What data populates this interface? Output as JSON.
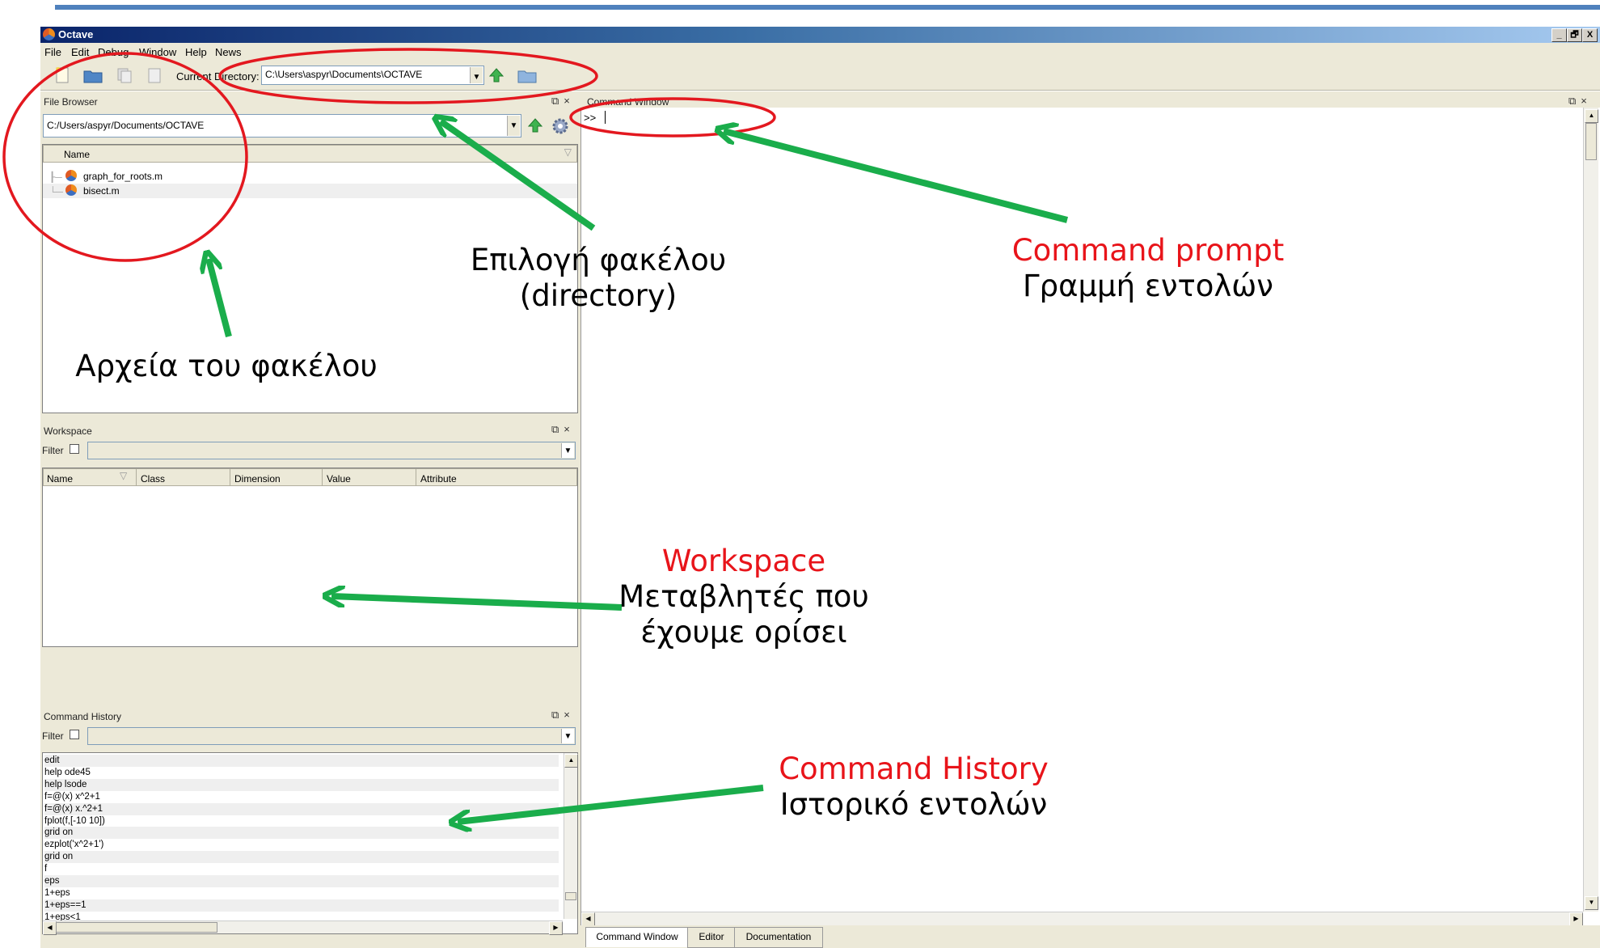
{
  "window": {
    "title": "Octave",
    "controls": [
      "_",
      "🗗",
      "X"
    ]
  },
  "menu": [
    "File",
    "Edit",
    "Debug",
    "Window",
    "Help",
    "News"
  ],
  "toolbar": {
    "dir_label": "Current Directory:",
    "dir_value": "C:\\Users\\aspyr\\Documents\\OCTAVE"
  },
  "file_browser": {
    "title": "File Browser",
    "path": "C:/Users/aspyr/Documents/OCTAVE",
    "column": "Name",
    "files": [
      "graph_for_roots.m",
      "bisect.m"
    ]
  },
  "workspace": {
    "title": "Workspace",
    "filter_label": "Filter",
    "columns": [
      "Name",
      "Class",
      "Dimension",
      "Value",
      "Attribute"
    ]
  },
  "history": {
    "title": "Command History",
    "filter_label": "Filter",
    "entries": [
      "edit",
      "help ode45",
      "help lsode",
      "f=@(x) x^2+1",
      "f=@(x) x.^2+1",
      "fplot(f,[-10 10])",
      "grid on",
      "ezplot('x^2+1')",
      "grid on",
      "f",
      "eps",
      "1+eps",
      "1+eps==1",
      "1+eps<1"
    ]
  },
  "command_window": {
    "title": "Command Window",
    "prompt": ">>"
  },
  "tabs": [
    "Command Window",
    "Editor",
    "Documentation"
  ],
  "annotations": {
    "folder_select": [
      "Επιλογή φακέλου",
      "(directory)"
    ],
    "command_prompt": {
      "title": "Command prompt",
      "subtitle": "Γραμμή εντολών"
    },
    "folder_files": "Αρχεία του φακέλου",
    "workspace": {
      "title": "Workspace",
      "lines": [
        "Μεταβλητές που",
        "έχουμε ορίσει"
      ]
    },
    "command_history": {
      "title": "Command History",
      "subtitle": "Ιστορικό εντολών"
    }
  },
  "colors": {
    "accent_red": "#e8141a",
    "arrow_green": "#1aad4b",
    "titlebar": "#0a246a"
  }
}
